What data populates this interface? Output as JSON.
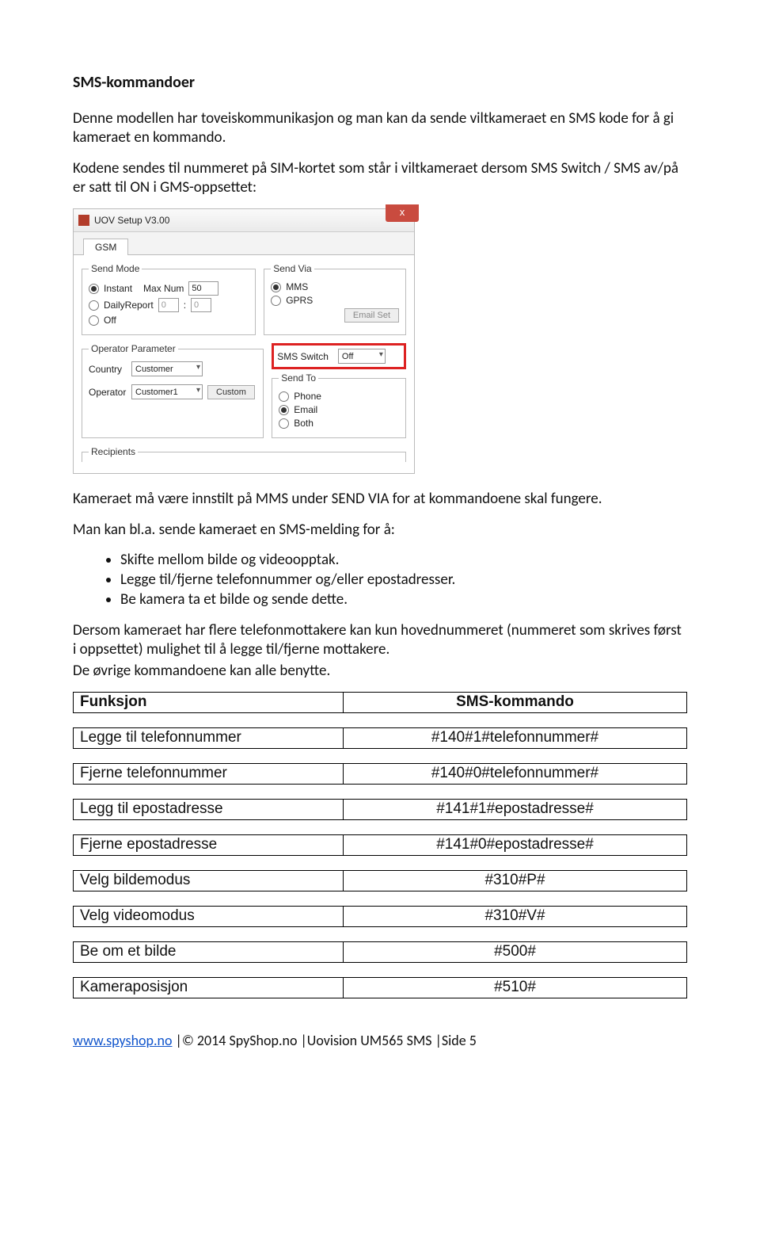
{
  "heading": "SMS-kommandoer",
  "para1": "Denne modellen har toveiskommunikasjon og man kan da sende viltkameraet en SMS kode for å gi kameraet en kommando.",
  "para2": "Kodene sendes til nummeret på SIM-kortet som står i viltkameraet dersom SMS Switch / SMS av/på er satt til ON i GMS-oppsettet:",
  "screenshot": {
    "title": "UOV Setup V3.00",
    "close": "x",
    "tab": "GSM",
    "sendMode": {
      "legend": "Send Mode",
      "instant": "Instant",
      "maxNum": "Max Num",
      "maxNumVal": "50",
      "daily": "DailyReport",
      "dailyH": "0",
      "dailyM": "0",
      "off": "Off"
    },
    "sendVia": {
      "legend": "Send Via",
      "mms": "MMS",
      "gprs": "GPRS",
      "emailSet": "Email Set"
    },
    "operator": {
      "legend": "Operator Parameter",
      "country": "Country",
      "countryVal": "Customer",
      "operator": "Operator",
      "operatorVal": "Customer1",
      "custom": "Custom"
    },
    "smsSwitch": {
      "label": "SMS Switch",
      "val": "Off"
    },
    "sendTo": {
      "legend": "Send To",
      "phone": "Phone",
      "email": "Email",
      "both": "Both"
    },
    "recipients": "Recipients"
  },
  "para3": "Kameraet må være innstilt på MMS under SEND VIA for at kommandoene skal fungere.",
  "para4": "Man kan bl.a. sende kameraet en SMS-melding for å:",
  "bullets": [
    "Skifte mellom bilde og videoopptak.",
    "Legge til/fjerne telefonnummer og/eller epostadresser.",
    "Be kamera ta et bilde og sende dette."
  ],
  "para5a": "Dersom kameraet har flere telefonmottakere kan kun hovednummeret (nummeret som skrives først i oppsettet) mulighet til å legge til/fjerne mottakere.",
  "para5b": "De øvrige kommandoene kan alle benytte.",
  "table": {
    "h1": "Funksjon",
    "h2": "SMS-kommando",
    "rows": [
      {
        "f": "Legge til telefonnummer",
        "c": "#140#1#telefonnummer#"
      },
      {
        "f": "Fjerne telefonnummer",
        "c": "#140#0#telefonnummer#"
      },
      {
        "f": "Legg til epostadresse",
        "c": "#141#1#epostadresse#"
      },
      {
        "f": "Fjerne epostadresse",
        "c": "#141#0#epostadresse#"
      },
      {
        "f": "Velg bildemodus",
        "c": "#310#P#"
      },
      {
        "f": "Velg videomodus",
        "c": "#310#V#"
      },
      {
        "f": "Be om et bilde",
        "c": "#500#"
      },
      {
        "f": "Kameraposisjon",
        "c": "#510#"
      }
    ]
  },
  "footer": {
    "link": "www.spyshop.no",
    "rest": " |© 2014 SpyShop.no |Uovision UM565 SMS |Side 5"
  }
}
